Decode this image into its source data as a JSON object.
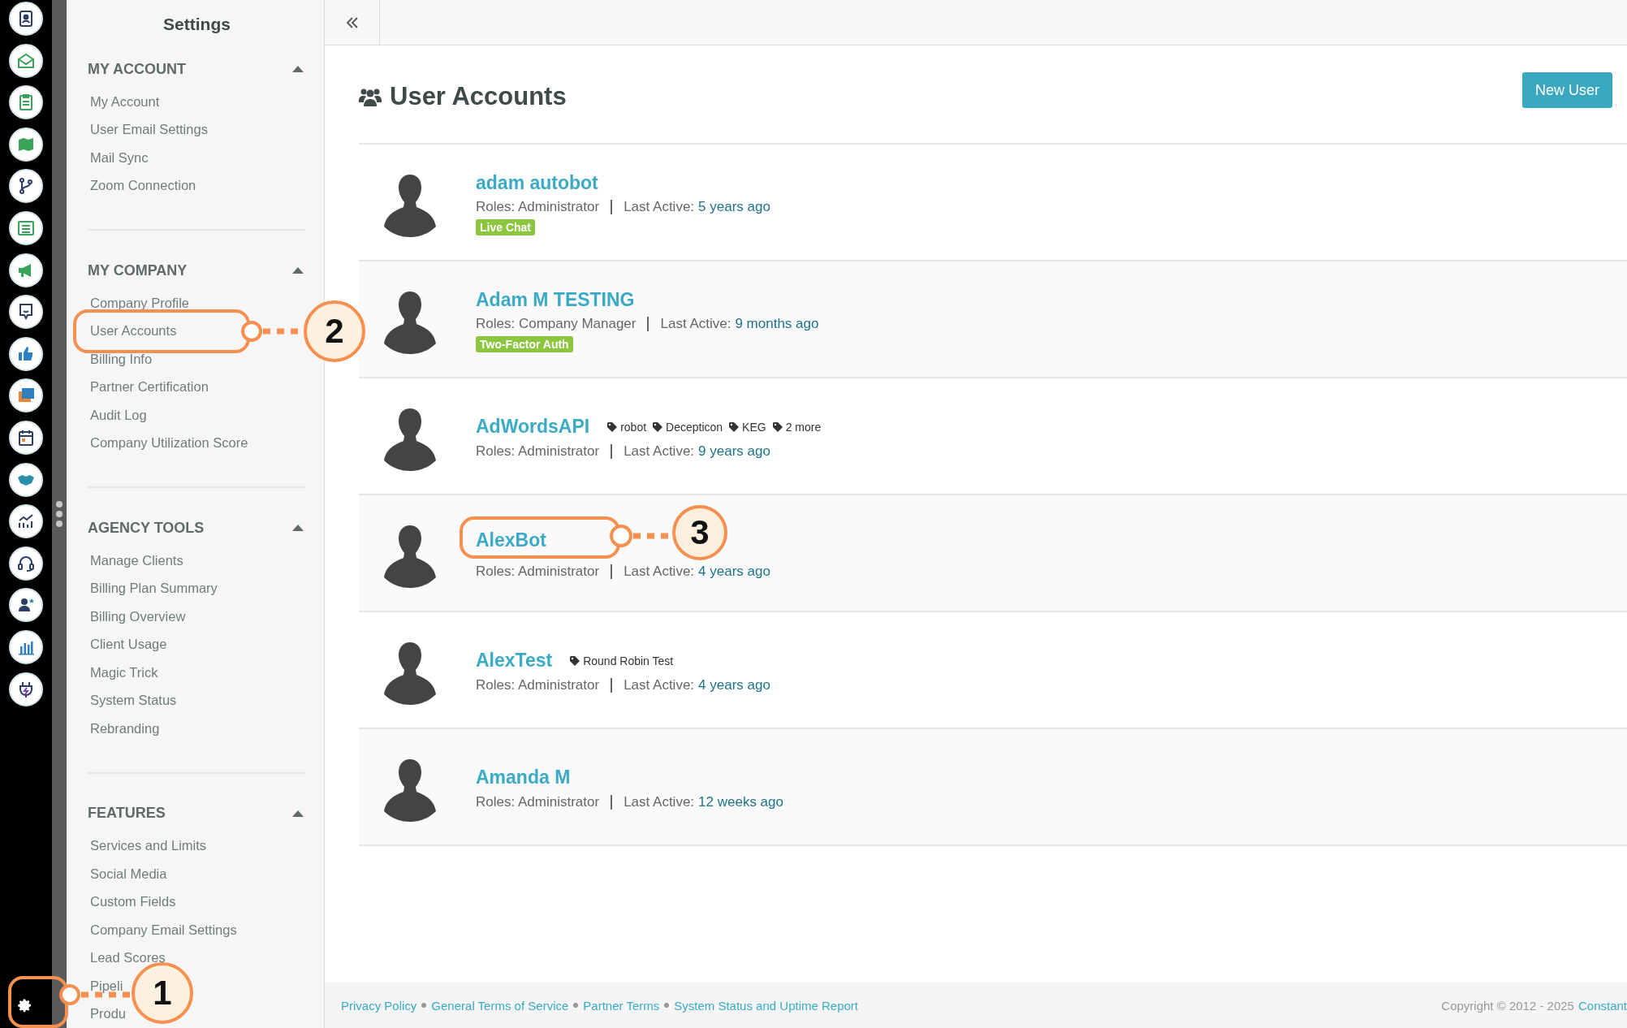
{
  "settings_button": {
    "callout": "1"
  },
  "sidebar": {
    "title": "Settings",
    "sections": [
      {
        "heading": "MY ACCOUNT",
        "expanded": true,
        "items": [
          {
            "label": "My Account"
          },
          {
            "label": "User Email Settings"
          },
          {
            "label": "Mail Sync"
          },
          {
            "label": "Zoom Connection"
          }
        ]
      },
      {
        "heading": "MY COMPANY",
        "expanded": true,
        "items": [
          {
            "label": "Company Profile"
          },
          {
            "label": "User Accounts",
            "callout": "2"
          },
          {
            "label": "Billing Info"
          },
          {
            "label": "Partner Certification"
          },
          {
            "label": "Audit Log"
          },
          {
            "label": "Company Utilization Score"
          }
        ]
      },
      {
        "heading": "AGENCY TOOLS",
        "expanded": true,
        "items": [
          {
            "label": "Manage Clients"
          },
          {
            "label": "Billing Plan Summary"
          },
          {
            "label": "Billing Overview"
          },
          {
            "label": "Client Usage"
          },
          {
            "label": "Magic Trick"
          },
          {
            "label": "System Status"
          },
          {
            "label": "Rebranding"
          }
        ]
      },
      {
        "heading": "FEATURES",
        "expanded": true,
        "items": [
          {
            "label": "Services and Limits"
          },
          {
            "label": "Social Media"
          },
          {
            "label": "Custom Fields"
          },
          {
            "label": "Company Email Settings"
          },
          {
            "label": "Lead Scores"
          },
          {
            "label": "Pipeli"
          },
          {
            "label": "Produ"
          }
        ]
      }
    ]
  },
  "page": {
    "title": "User Accounts",
    "new_user_button": "New User"
  },
  "users": [
    {
      "name": "adam autobot",
      "roles": "Roles: Administrator",
      "last_active_label": "Last Active:",
      "last_active": "5 years ago",
      "badges": [
        "Live Chat"
      ]
    },
    {
      "name": "Adam M TESTING",
      "roles": "Roles: Company Manager",
      "last_active_label": "Last Active:",
      "last_active": "9 months ago",
      "badges": [
        "Two-Factor Auth"
      ]
    },
    {
      "name": "AdWordsAPI",
      "roles": "Roles: Administrator",
      "last_active_label": "Last Active:",
      "last_active": "9 years ago",
      "tags": [
        "robot",
        "Decepticon",
        "KEG",
        "2 more"
      ]
    },
    {
      "name": "AlexBot",
      "roles": "Roles: Administrator",
      "last_active_label": "Last Active:",
      "last_active": "4 years ago",
      "callout": "3"
    },
    {
      "name": "AlexTest",
      "roles": "Roles: Administrator",
      "last_active_label": "Last Active:",
      "last_active": "4 years ago",
      "tags": [
        "Round Robin Test"
      ]
    },
    {
      "name": "Amanda M",
      "roles": "Roles: Administrator",
      "last_active_label": "Last Active:",
      "last_active": "12 weeks ago"
    }
  ],
  "footer": {
    "links": [
      "Privacy Policy",
      "General Terms of Service",
      "Partner Terms",
      "System Status and Uptime Report"
    ],
    "copyright": "Copyright © 2012 - 2025",
    "company_link": "Constant"
  }
}
